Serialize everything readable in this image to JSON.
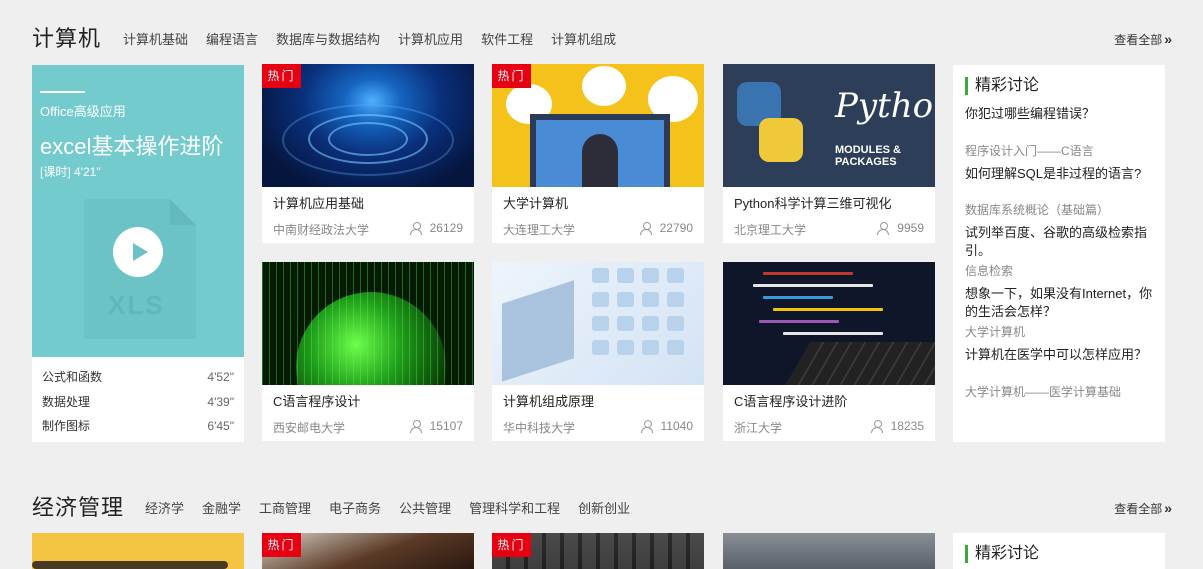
{
  "sections": [
    {
      "title": "计算机",
      "tabs": [
        "计算机基础",
        "编程语言",
        "数据库与数据结构",
        "计算机应用",
        "软件工程",
        "计算机组成"
      ],
      "view_all": "查看全部",
      "feature": {
        "category": "Office高级应用",
        "title": "excel基本操作进阶",
        "meta": "[课时] 4'21\"",
        "doc_label": "XLS",
        "lessons": [
          {
            "name": "公式和函数",
            "duration": "4'52\""
          },
          {
            "name": "数据处理",
            "duration": "4'39\""
          },
          {
            "name": "制作图标",
            "duration": "6'45\""
          }
        ]
      },
      "cards": [
        {
          "title": "计算机应用基础",
          "school": "中南财经政法大学",
          "count": "26129",
          "hot": true,
          "hot_label": "热门"
        },
        {
          "title": "大学计算机",
          "school": "大连理工大学",
          "count": "22790",
          "hot": true,
          "hot_label": "热门"
        },
        {
          "title": "Python科学计算三维可视化",
          "school": "北京理工大学",
          "count": "9959",
          "hot": false,
          "thumb_word": "Python",
          "thumb_sub": "MODULES & PACKAGES"
        },
        {
          "title": "C语言程序设计",
          "school": "西安邮电大学",
          "count": "15107",
          "hot": false
        },
        {
          "title": "计算机组成原理",
          "school": "华中科技大学",
          "count": "11040",
          "hot": false
        },
        {
          "title": "C语言程序设计进阶",
          "school": "浙江大学",
          "count": "18235",
          "hot": false
        }
      ],
      "discussion": {
        "title": "精彩讨论",
        "items": [
          {
            "question": "你犯过哪些编程错误？",
            "course": "程序设计入门——C语言"
          },
          {
            "question": "如何理解SQL是非过程的语言?",
            "course": "数据库系统概论（基础篇）"
          },
          {
            "question": "试列举百度、谷歌的高级检索指引。",
            "course": "信息检索"
          },
          {
            "question": "想象一下，如果没有Internet，你的生活会怎样？",
            "course": "大学计算机"
          },
          {
            "question": "计算机在医学中可以怎样应用？",
            "course": "大学计算机——医学计算基础"
          }
        ]
      }
    },
    {
      "title": "经济管理",
      "tabs": [
        "经济学",
        "金融学",
        "工商管理",
        "电子商务",
        "公共管理",
        "管理科学和工程",
        "创新创业"
      ],
      "view_all": "查看全部",
      "cards": [
        {
          "hot": true,
          "hot_label": "热门"
        },
        {
          "hot": true,
          "hot_label": "热门"
        },
        {
          "hot": false
        }
      ],
      "discussion": {
        "title": "精彩讨论"
      }
    }
  ],
  "colors": {
    "hot": "#e60012",
    "feature": "#73cbce",
    "accent": "#3aaa35"
  }
}
